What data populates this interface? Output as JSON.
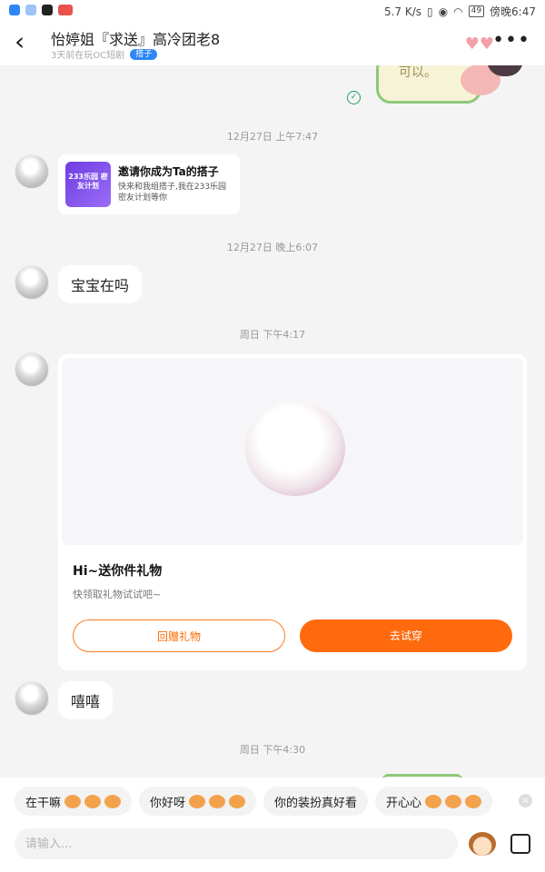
{
  "status_bar": {
    "speed": "5.7 K/s",
    "battery": "49",
    "time": "傍晚6:47"
  },
  "header": {
    "title": "怡婷姐『求送』高冷团老8",
    "subtitle": "3天前在玩OC短剧",
    "badge": "搭子"
  },
  "chat": {
    "sticker_text": "可以。",
    "timestamps": [
      "12月27日 上午7:47",
      "12月27日 晚上6:07",
      "周日 下午4:17",
      "周日 下午4:30"
    ],
    "invite": {
      "image_text": "233乐园 密友计划",
      "title": "邀请你成为Ta的搭子",
      "desc": "快来和我组搭子,我在233乐园密友计划等你"
    },
    "messages": [
      "宝宝在吗",
      "嘻嘻"
    ],
    "gift": {
      "title": "Hi~送你件礼物",
      "subtitle": "快领取礼物试试吧~",
      "return_button": "回赠礼物",
      "try_button": "去试穿"
    }
  },
  "quick_replies": [
    {
      "text": "在干嘛",
      "emojis": 3
    },
    {
      "text": "你好呀",
      "emojis": 3
    },
    {
      "text": "你的装扮真好看",
      "emojis": 0
    },
    {
      "text": "开心心",
      "emojis": 3
    }
  ],
  "input": {
    "placeholder": "请输入..."
  },
  "icons": {
    "back": "chevron-left-icon",
    "more": "more-dots-icon",
    "hearts": "hearts-icon",
    "sent": "check-circle-icon",
    "close": "close-icon",
    "emoji": "monkey-emoji-icon",
    "image": "image-icon"
  }
}
